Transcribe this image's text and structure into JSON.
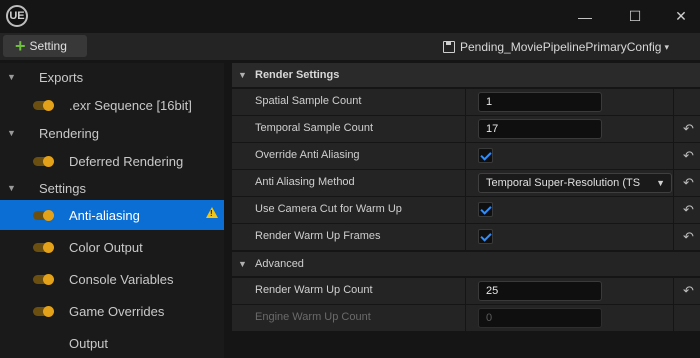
{
  "window": {
    "logo": "UE",
    "minimize_glyph": "—",
    "maximize_glyph": "☐",
    "close_glyph": "✕"
  },
  "toolbar": {
    "add_glyph": "+",
    "setting_label": "Setting",
    "preset_name": "Pending_MoviePipelinePrimaryConfig",
    "preset_chevron": "▾"
  },
  "tree": {
    "exports_label": "Exports",
    "exr_label": ".exr Sequence [16bit]",
    "rendering_label": "Rendering",
    "deferred_label": "Deferred Rendering",
    "settings_label": "Settings",
    "antialiasing_label": "Anti-aliasing",
    "warning_glyph": "!",
    "color_output_label": "Color Output",
    "console_vars_label": "Console Variables",
    "game_overrides_label": "Game Overrides",
    "output_label": "Output",
    "caret_glyph": "▼"
  },
  "details": {
    "render_settings_title": "Render Settings",
    "spatial_label": "Spatial Sample Count",
    "spatial_value": "1",
    "temporal_label": "Temporal Sample Count",
    "temporal_value": "17",
    "override_aa_label": "Override Anti Aliasing",
    "aa_method_label": "Anti Aliasing Method",
    "aa_method_value": "Temporal Super-Resolution (TS",
    "camera_cut_label": "Use Camera Cut for Warm Up",
    "warm_frames_label": "Render Warm Up Frames",
    "advanced_title": "Advanced",
    "warm_count_label": "Render Warm Up Count",
    "warm_count_value": "25",
    "engine_warm_label": "Engine Warm Up Count",
    "engine_warm_value": "0",
    "reset_glyph": "↶",
    "dropdown_chevron": "▼"
  },
  "colors": {
    "accent": "#0a6ed4",
    "toggle": "#e3a21a",
    "check": "#2f8fff",
    "warning": "#f0c419"
  }
}
